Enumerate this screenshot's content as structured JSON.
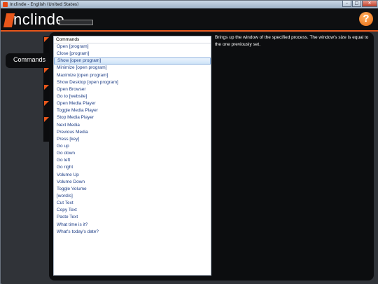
{
  "window": {
    "title": "Inclinde - English (United States)",
    "controls": {
      "minimize": "–",
      "maximize": "□",
      "close": "✕"
    }
  },
  "header": {
    "logo_text": "nclinde",
    "help_label": "?"
  },
  "tabs": [
    {
      "label": "Commands",
      "selected": true
    }
  ],
  "commands": {
    "header": "Commands",
    "selected_index": 2,
    "items": [
      "Open [program]",
      "Close [program]",
      "Show [open program]",
      "Minimize [open program]",
      "Maximize [open program]",
      "Show Desktop [open program]",
      "Open Browser",
      "Go to [website]",
      "Open Media Player",
      "Toggle Media Player",
      "Stop Media Player",
      "Next Media",
      "Previous Media",
      "Press [key]",
      "Go up",
      "Go down",
      "Go left",
      "Go right",
      "Volume Up",
      "Volume Down",
      "Toggle Volume",
      "[word/s]",
      "Cut Text",
      "Copy Text",
      "Paste Text",
      "What time is it?",
      "What's today's date?"
    ]
  },
  "description": "Brings up the window of the specified process. The window's size is equal to the one previously set.",
  "colors": {
    "accent": "#e8561a",
    "background": "#303338",
    "panel": "#0c0d0f",
    "link_text": "#1d3d85"
  }
}
